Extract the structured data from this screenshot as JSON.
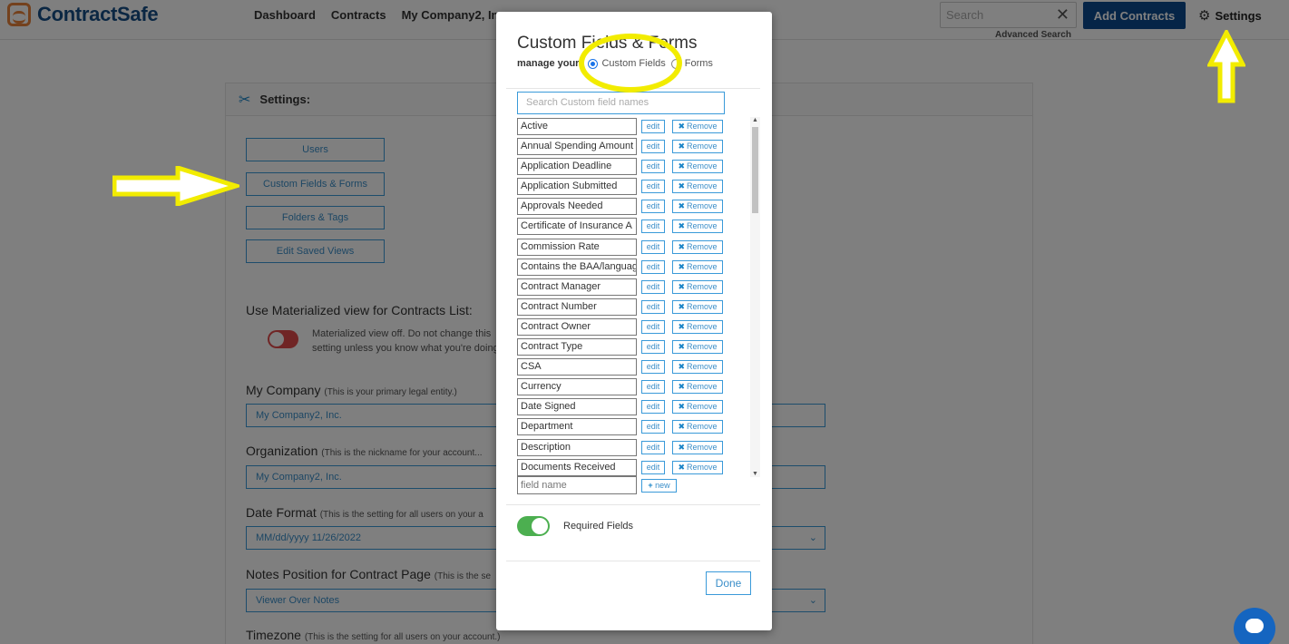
{
  "header": {
    "logo_text": "ContractSafe",
    "nav": [
      "Dashboard",
      "Contracts",
      "My Company2, Inc"
    ],
    "search_placeholder": "Search",
    "clear_symbol": "✕",
    "advanced_search": "Advanced Search",
    "add_contracts": "Add Contracts",
    "settings": "Settings"
  },
  "settings_panel": {
    "title": "Settings:",
    "buttons": [
      "Users",
      "Custom Fields & Forms",
      "Folders & Tags",
      "Edit Saved Views"
    ],
    "materialized_label": "Use Materialized view for Contracts List:",
    "materialized_text": "Materialized view off. Do not change this setting unless you know what you're doing.",
    "my_company_label": "My Company",
    "my_company_hint": "(This is your primary legal entity.)",
    "my_company_value": "My Company2, Inc.",
    "organization_label": "Organization",
    "organization_hint": "(This is the nickname for your account...",
    "organization_value": "My Company2, Inc.",
    "date_format_label": "Date Format",
    "date_format_hint": "(This is the setting for all users on your a",
    "date_format_value": "MM/dd/yyyy 11/26/2022",
    "notes_label": "Notes Position for Contract Page",
    "notes_hint": "(This is the se",
    "notes_value": "Viewer Over Notes",
    "timezone_label": "Timezone",
    "timezone_hint": "(This is the setting for all users on your account.)"
  },
  "modal": {
    "title": "Custom Fields & Forms",
    "manage_label": "manage your",
    "radio_custom_fields": "Custom Fields",
    "radio_forms": "Forms",
    "search_placeholder": "Search Custom field names",
    "edit_label": "edit",
    "remove_label": "Remove",
    "fields": [
      "Active",
      "Annual Spending Amount",
      "Application Deadline",
      "Application Submitted",
      "Approvals Needed",
      "Certificate of Insurance A",
      "Commission Rate",
      "Contains the BAA/languag",
      "Contract Manager",
      "Contract Number",
      "Contract Owner",
      "Contract Type",
      "CSA",
      "Currency",
      "Date Signed",
      "Department",
      "Description",
      "Documents Received"
    ],
    "new_field_placeholder": "field name",
    "new_label": "new",
    "required_fields_label": "Required Fields",
    "done": "Done"
  },
  "colors": {
    "brand_blue": "#0d4a8f",
    "accent_blue": "#3a9ad9",
    "annotation_yellow": "#f2ec00",
    "toggle_on": "#4caf50",
    "toggle_off": "#e04b4b"
  }
}
